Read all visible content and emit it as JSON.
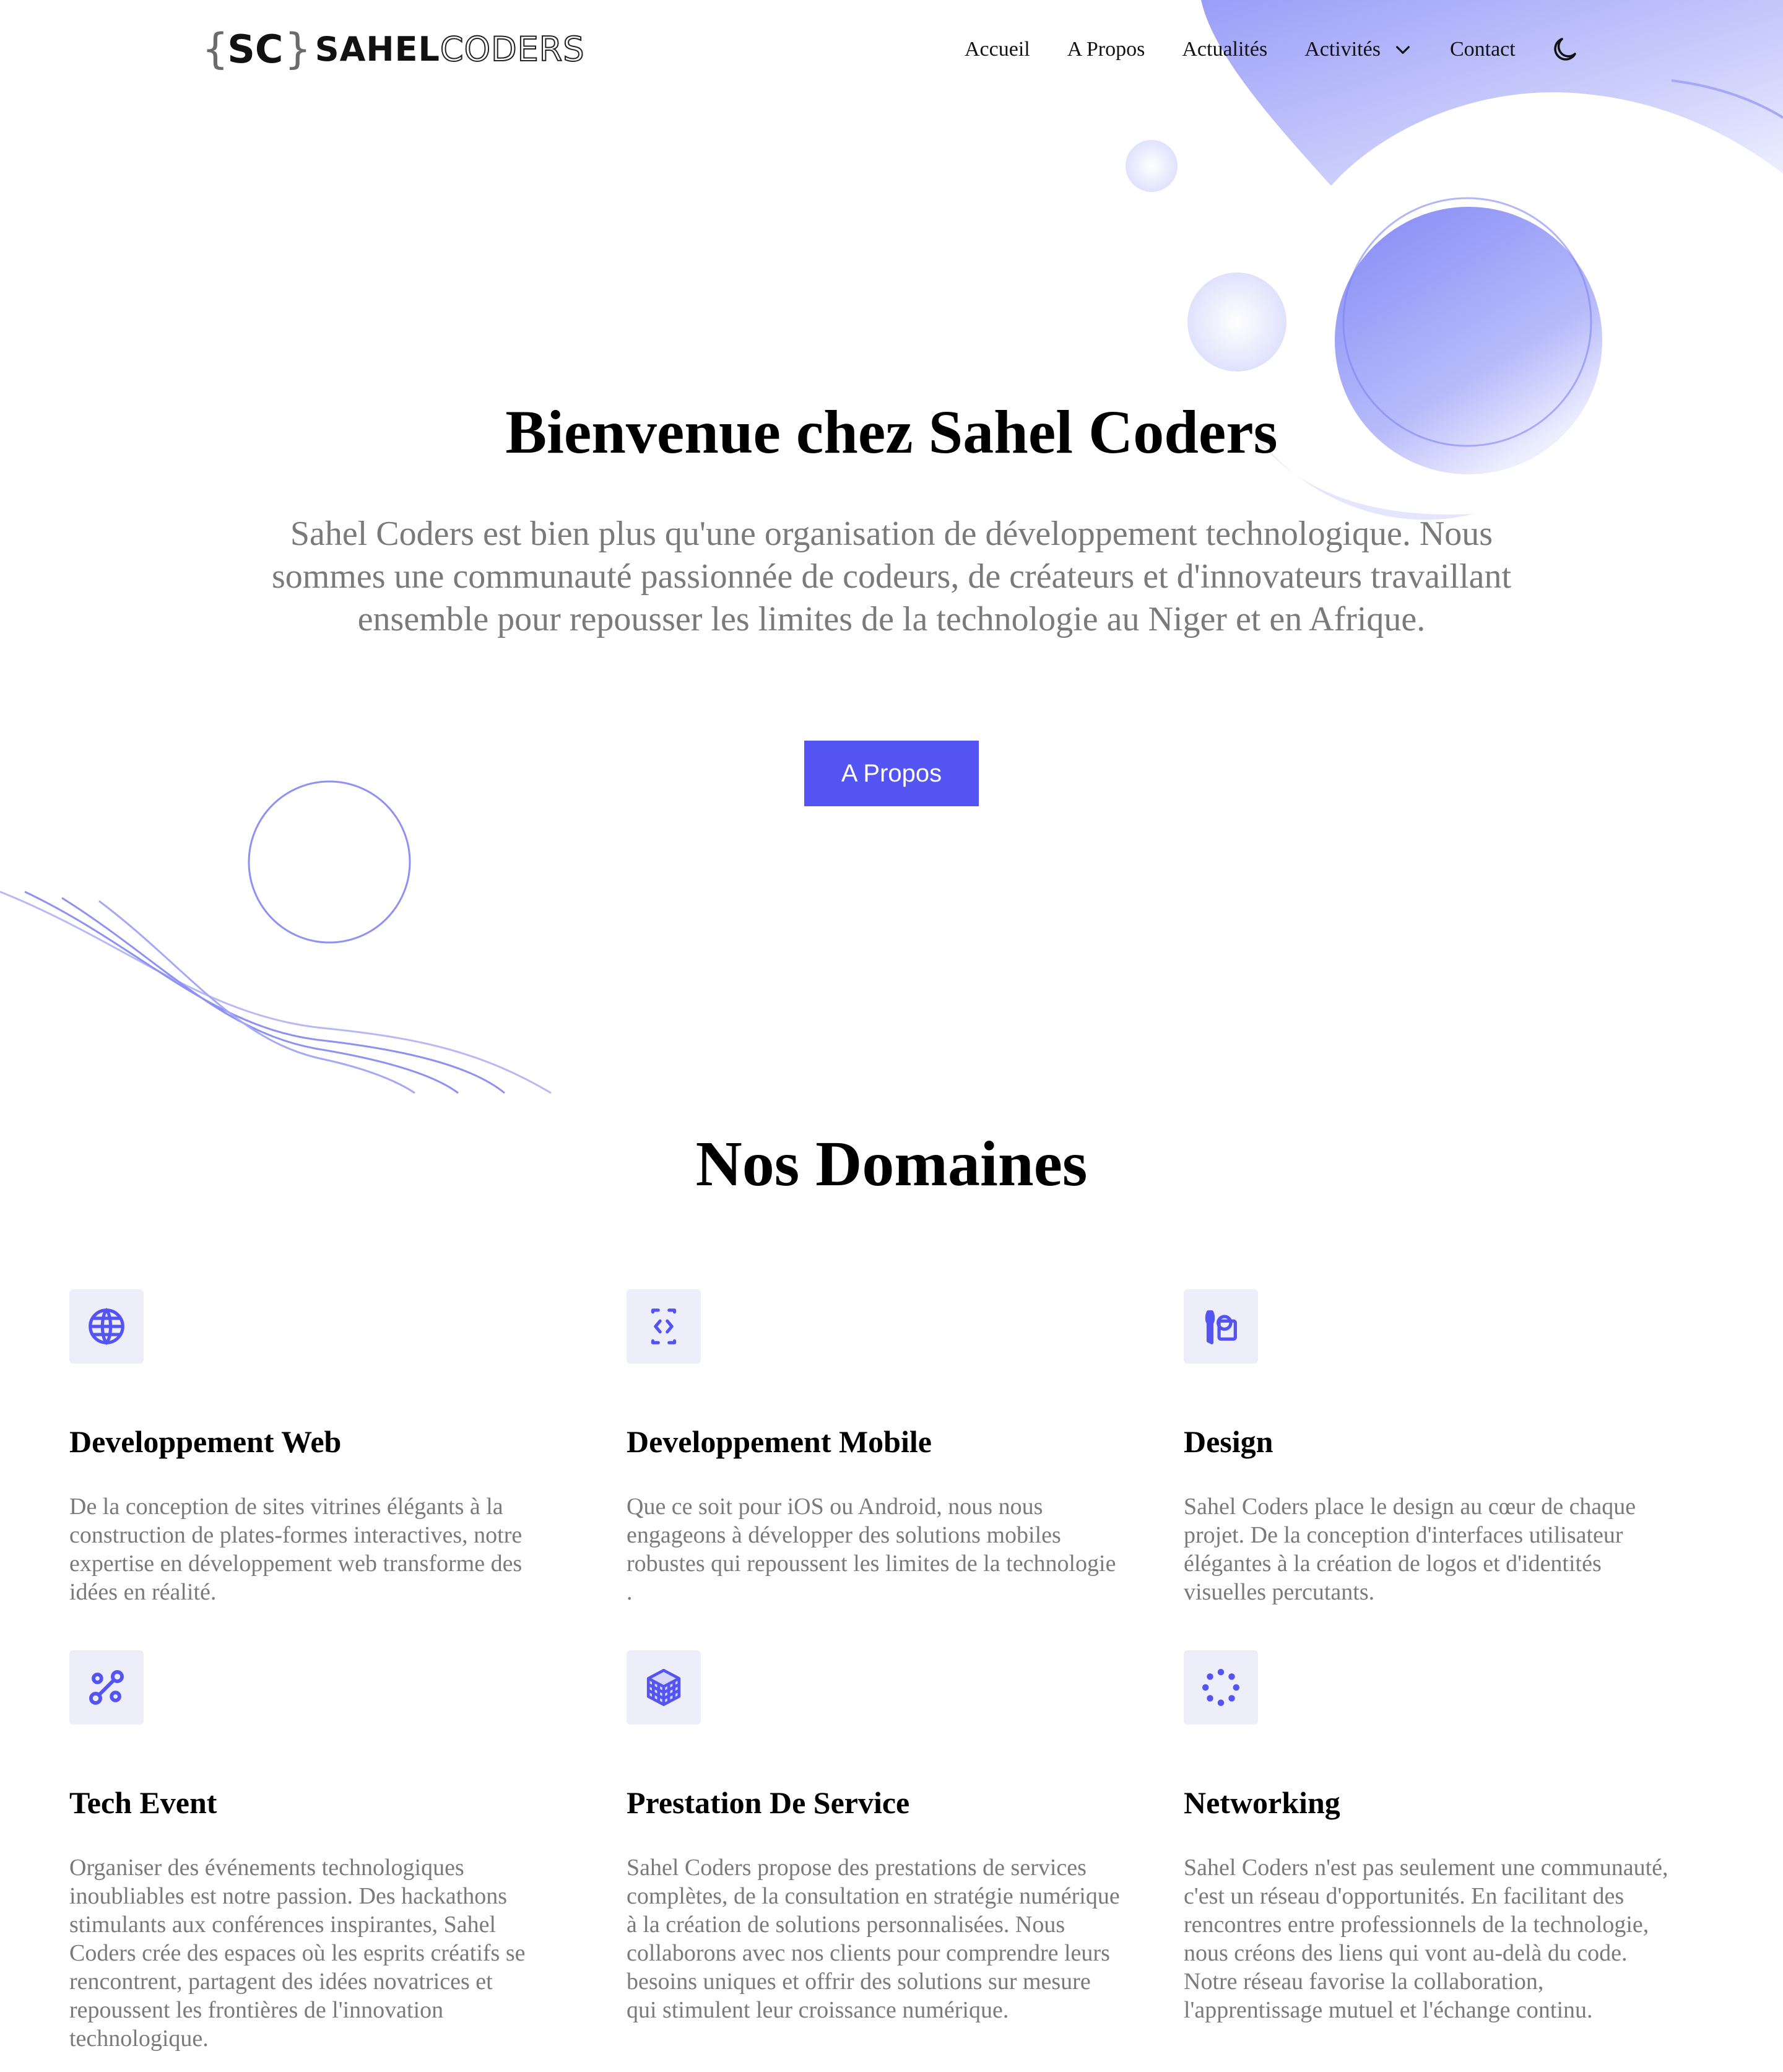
{
  "brand": {
    "mark_open": "{",
    "mark_letters": "SC",
    "mark_close": "}",
    "word_bold": "SAHEL",
    "word_outline": "CODERS"
  },
  "nav": {
    "items": [
      "Accueil",
      "A Propos",
      "Actualités",
      "Activités",
      "Contact"
    ]
  },
  "hero": {
    "title": "Bienvenue chez Sahel Coders",
    "text": "Sahel Coders est bien plus qu'une organisation de développement technologique. Nous sommes une communauté passionnée de codeurs, de créateurs et d'innovateurs travaillant ensemble pour repousser les limites de la technologie au Niger et en Afrique.",
    "button": "A Propos"
  },
  "domains": {
    "title": "Nos Domaines",
    "items": [
      {
        "icon": "globe-icon",
        "title": "Developpement Web",
        "text": "De la conception de sites vitrines élégants à la construction de plates-formes interactives, notre expertise en développement web transforme des idées en réalité."
      },
      {
        "icon": "code-icon",
        "title": "Developpement Mobile",
        "text": "Que ce soit pour iOS ou Android, nous nous engageons à développer des solutions mobiles robustes qui repoussent les limites de la technologie ."
      },
      {
        "icon": "design-icon",
        "title": "Design",
        "text": "Sahel Coders place le design au cœur de chaque projet. De la conception d'interfaces utilisateur élégantes à la création de logos et d'identités visuelles percutants."
      },
      {
        "icon": "route-icon",
        "title": "Tech Event",
        "text": "Organiser des événements technologiques inoubliables est notre passion. Des hackathons stimulants aux conférences inspirantes, Sahel Coders crée des espaces où les esprits créatifs se rencontrent, partagent des idées novatrices et repoussent les frontières de l'innovation technologique."
      },
      {
        "icon": "cube-icon",
        "title": "Prestation De Service",
        "text": "Sahel Coders propose des prestations de services complètes, de la consultation en stratégie numérique à la création de solutions personnalisées. Nous collaborons avec nos clients pour comprendre leurs besoins uniques et offrir des solutions sur mesure qui stimulent leur croissance numérique."
      },
      {
        "icon": "network-icon",
        "title": "Networking",
        "text": "Sahel Coders n'est pas seulement une communauté, c'est un réseau d'opportunités. En facilitant des rencontres entre professionnels de la technologie, nous créons des liens qui vont au-delà du code. Notre réseau favorise la collaboration, l'apprentissage mutuel et l'échange continu."
      }
    ]
  },
  "colors": {
    "accent": "#5454f2",
    "icon_bg": "#eeeefb",
    "muted_text": "#7a7a7a"
  }
}
